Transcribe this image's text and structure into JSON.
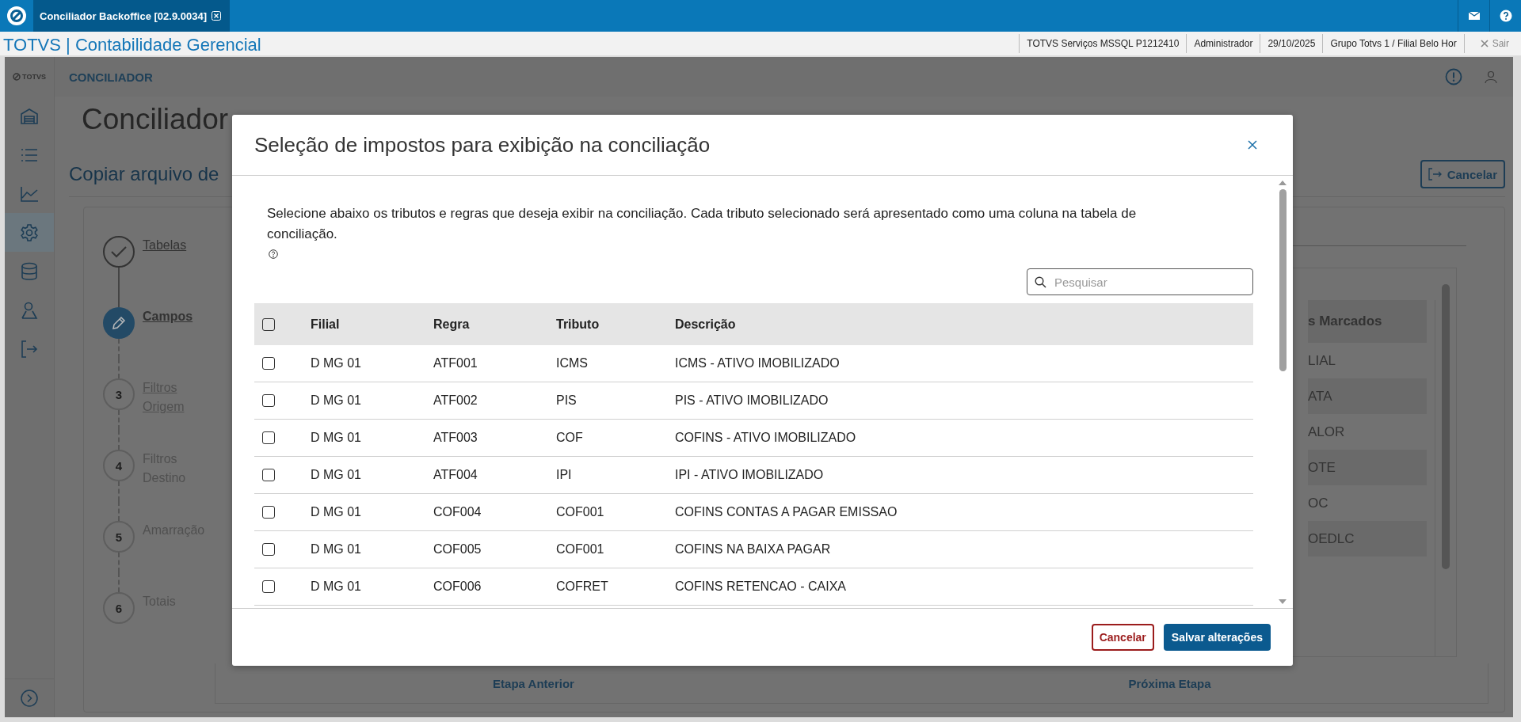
{
  "app_bar": {
    "tab_title": "Conciliador Backoffice [02.9.0034]"
  },
  "header": {
    "title": "TOTVS | Contabilidade Gerencial",
    "info": [
      "TOTVS Serviços MSSQL P1212410",
      "Administrador",
      "29/10/2025",
      "Grupo Totvs 1 / Filial Belo Hor"
    ],
    "logout": "Sair"
  },
  "sidebar": {
    "logo": "TOTVS",
    "items": [
      {
        "kind": "building",
        "selected": false
      },
      {
        "kind": "list",
        "selected": false
      },
      {
        "kind": "chart",
        "selected": false
      },
      {
        "kind": "gear",
        "selected": true
      },
      {
        "kind": "database",
        "selected": false
      },
      {
        "kind": "person",
        "selected": false
      },
      {
        "kind": "logout",
        "selected": false
      }
    ]
  },
  "page": {
    "section": "CONCILIADOR",
    "title": "Conciliador",
    "subtitle": "Copiar arquivo de",
    "cancel": "Cancelar",
    "steps": [
      {
        "kind": "done",
        "label": "Tabelas",
        "underlined": true
      },
      {
        "kind": "current",
        "label": "Campos",
        "underlined": true
      },
      {
        "kind": "pending",
        "number": "3",
        "label": "Filtros Origem",
        "underlined": true
      },
      {
        "kind": "pending",
        "number": "4",
        "label": "Filtros Destino",
        "underlined": false
      },
      {
        "kind": "pending",
        "number": "5",
        "label": "Amarração",
        "underlined": false
      },
      {
        "kind": "pending",
        "number": "6",
        "label": "Totais",
        "underlined": false
      }
    ],
    "fields_header": "s Marcados",
    "fields": [
      "LIAL",
      "ATA",
      "ALOR",
      "OTE",
      "OC",
      "OEDLC"
    ],
    "prev": "Etapa Anterior",
    "next": "Próxima Etapa"
  },
  "modal": {
    "title": "Seleção de impostos para exibição na conciliação",
    "description": "Selecione abaixo os tributos e regras que deseja exibir na conciliação. Cada tributo selecionado será apresentado como uma coluna na tabela de conciliação.",
    "search": {
      "placeholder": "Pesquisar"
    },
    "select_all": {
      "checked": false
    },
    "columns": [
      "Filial",
      "Regra",
      "Tributo",
      "Descrição"
    ],
    "rows": [
      {
        "checked": false,
        "cells": [
          "D MG 01",
          "ATF001",
          "ICMS",
          "ICMS - ATIVO IMOBILIZADO"
        ]
      },
      {
        "checked": false,
        "cells": [
          "D MG 01",
          "ATF002",
          "PIS",
          "PIS - ATIVO IMOBILIZADO"
        ]
      },
      {
        "checked": false,
        "cells": [
          "D MG 01",
          "ATF003",
          "COF",
          "COFINS - ATIVO IMOBILIZADO"
        ]
      },
      {
        "checked": false,
        "cells": [
          "D MG 01",
          "ATF004",
          "IPI",
          "IPI - ATIVO IMOBILIZADO"
        ]
      },
      {
        "checked": false,
        "cells": [
          "D MG 01",
          "COF004",
          "COF001",
          "COFINS CONTAS A PAGAR EMISSAO"
        ]
      },
      {
        "checked": false,
        "cells": [
          "D MG 01",
          "COF005",
          "COF001",
          "COFINS NA BAIXA PAGAR"
        ]
      },
      {
        "checked": false,
        "cells": [
          "D MG 01",
          "COF006",
          "COFRET",
          "COFINS RETENCAO - CAIXA"
        ]
      }
    ],
    "cancel": "Cancelar",
    "save": "Salvar alterações"
  }
}
